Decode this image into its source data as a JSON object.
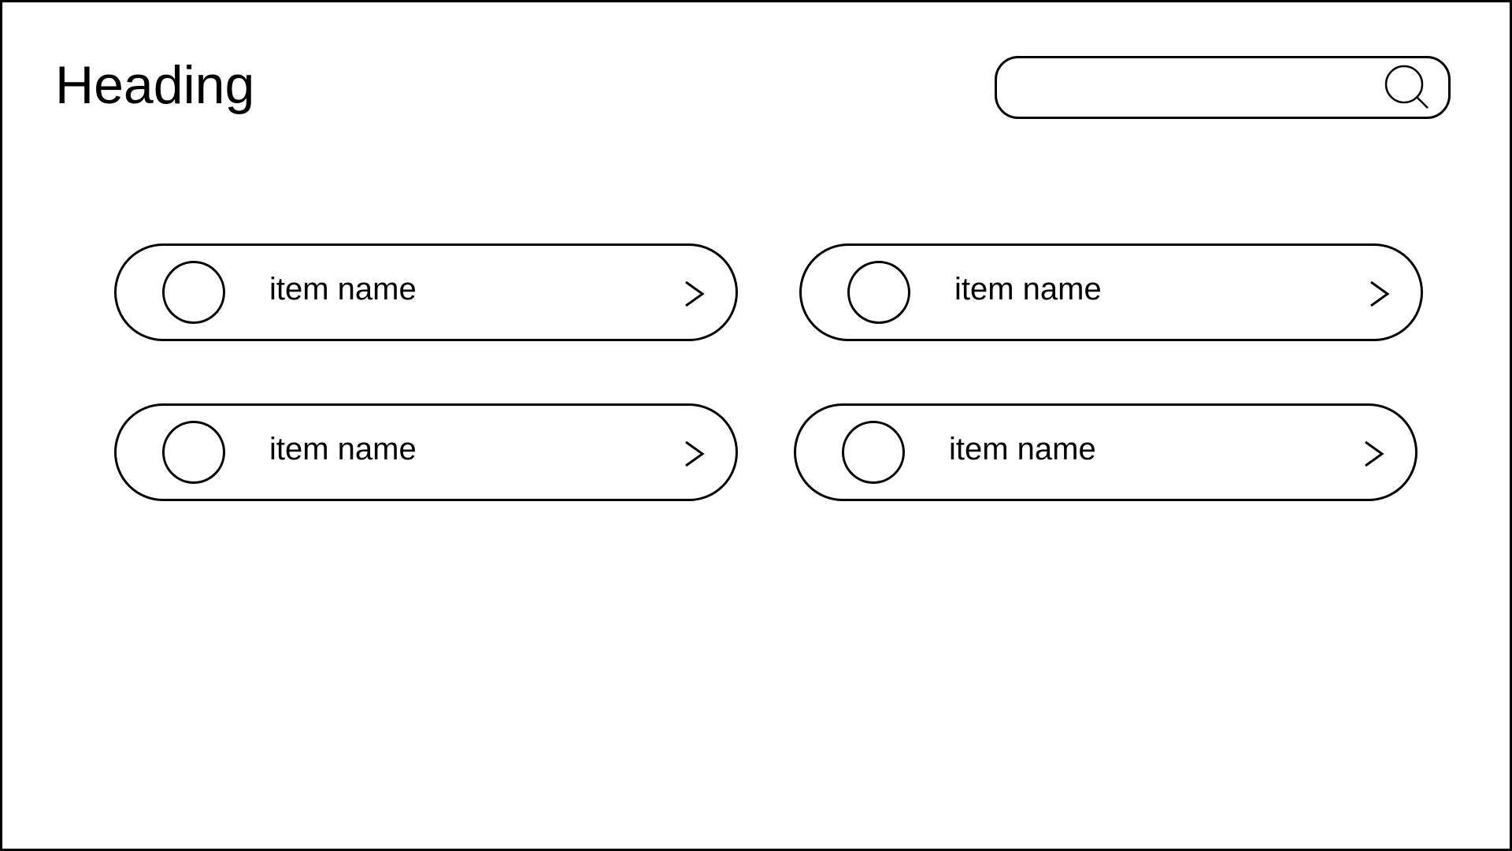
{
  "header": {
    "title": "Heading"
  },
  "search": {
    "value": "",
    "placeholder": "",
    "icon": "search-icon"
  },
  "items": [
    {
      "label": "item name",
      "icon": "circle-avatar",
      "chevron": "chevron-right-icon"
    },
    {
      "label": "item name",
      "icon": "circle-avatar",
      "chevron": "chevron-right-icon"
    },
    {
      "label": "item name",
      "icon": "circle-avatar",
      "chevron": "chevron-right-icon"
    },
    {
      "label": "item name",
      "icon": "circle-avatar",
      "chevron": "chevron-right-icon"
    }
  ],
  "colors": {
    "stroke": "#000000",
    "background": "#ffffff"
  }
}
